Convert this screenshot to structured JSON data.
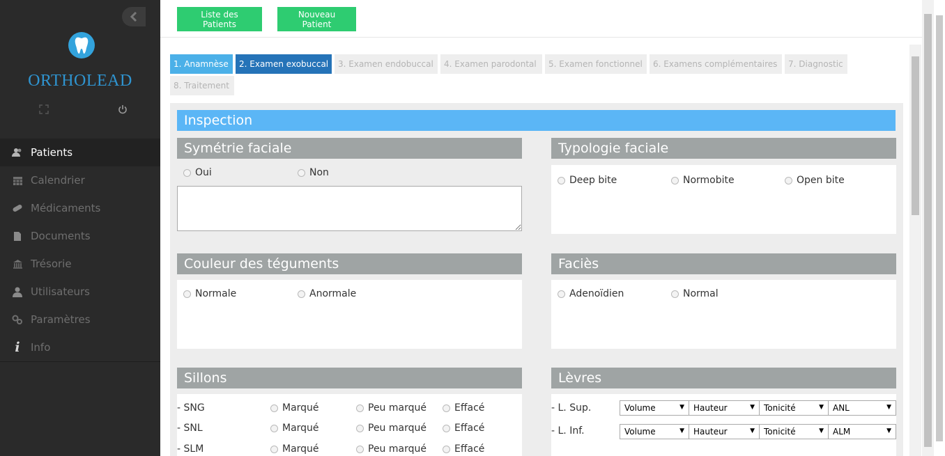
{
  "sidebar": {
    "brand": "ORTHOLEAD",
    "items": [
      {
        "label": "Patients",
        "icon": "users-icon",
        "active": true
      },
      {
        "label": "Calendrier",
        "icon": "calendar-icon"
      },
      {
        "label": "Médicaments",
        "icon": "pill-icon"
      },
      {
        "label": "Documents",
        "icon": "document-icon"
      },
      {
        "label": "Trésorie",
        "icon": "bank-icon"
      },
      {
        "label": "Utilisateurs",
        "icon": "user-icon"
      },
      {
        "label": "Paramètres",
        "icon": "gears-icon"
      },
      {
        "label": "Info",
        "icon": "info-icon"
      }
    ]
  },
  "topbar": {
    "list_button": "Liste des Patients",
    "new_button": "Nouveau Patient"
  },
  "tabs": [
    "1. Anamnèse",
    "2. Examen exobuccal",
    "3. Examen endobuccal",
    "4. Examen parodontal",
    "5. Examen fonctionnel",
    "6. Examens complémentaires",
    "7. Diagnostic",
    "8. Traitement"
  ],
  "form": {
    "inspection_title": "Inspection",
    "symetrie": {
      "title": "Symétrie faciale",
      "options": [
        "Oui",
        "Non"
      ]
    },
    "typologie": {
      "title": "Typologie faciale",
      "options": [
        "Deep bite",
        "Normobite",
        "Open bite"
      ]
    },
    "couleur": {
      "title": "Couleur des téguments",
      "options": [
        "Normale",
        "Anormale"
      ]
    },
    "facies": {
      "title": "Faciès",
      "options": [
        "Adenoïdien",
        "Normal"
      ]
    },
    "sillons": {
      "title": "Sillons",
      "rows": [
        {
          "label": "- SNG",
          "options": [
            "Marqué",
            "Peu marqué",
            "Effacé"
          ]
        },
        {
          "label": "- SNL",
          "options": [
            "Marqué",
            "Peu marqué",
            "Effacé"
          ]
        },
        {
          "label": "- SLM",
          "options": [
            "Marqué",
            "Peu marqué",
            "Effacé"
          ]
        }
      ]
    },
    "levres": {
      "title": "Lèvres",
      "rows": [
        {
          "label": "- L. Sup.",
          "selects": [
            "Volume",
            "Hauteur",
            "Tonicité",
            "ANL"
          ]
        },
        {
          "label": "- L. Inf.",
          "selects": [
            "Volume",
            "Hauteur",
            "Tonicité",
            "ALM"
          ]
        }
      ]
    }
  },
  "colors": {
    "sidebar_bg": "#2a2a2a",
    "brand": "#2f94d0",
    "green_button": "#2ecc71",
    "tab_done": "#4bb0e8",
    "tab_current": "#2573b8",
    "inspection_bar": "#5bb6f6",
    "panel_title": "#9fa4a4"
  }
}
